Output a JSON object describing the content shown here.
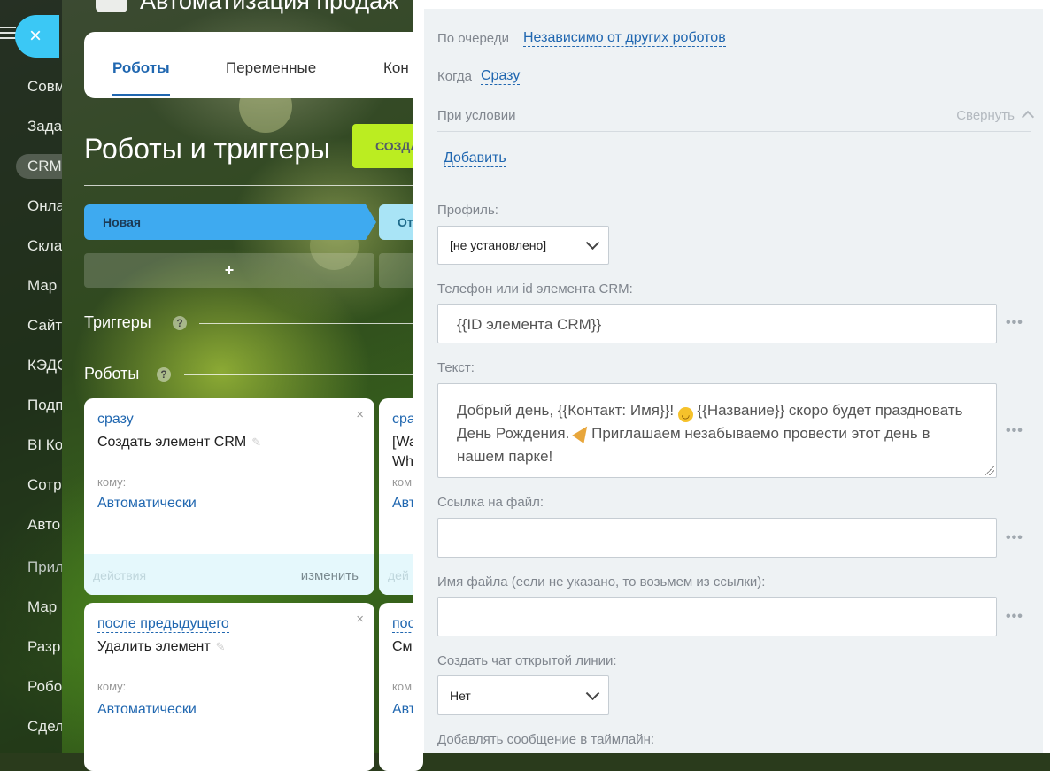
{
  "header": {
    "page_title": "Автоматизация продаж",
    "tabs": [
      {
        "label": "Роботы"
      },
      {
        "label": "Переменные"
      },
      {
        "label": "Кон"
      }
    ]
  },
  "left_menu": {
    "close_glyph": "×",
    "items": [
      {
        "label": "Совм"
      },
      {
        "label": "Зада"
      },
      {
        "label": "CRM"
      },
      {
        "label": "Онла"
      },
      {
        "label": "Скла"
      },
      {
        "label": "Мар"
      },
      {
        "label": "Сайт"
      },
      {
        "label": "КЭДО"
      },
      {
        "label": "Подп"
      },
      {
        "label": "BI Ко"
      },
      {
        "label": "Сотр"
      },
      {
        "label": "Авто"
      },
      {
        "label": "Прил"
      },
      {
        "label": "Мар"
      },
      {
        "label": "Разр"
      },
      {
        "label": "Робо"
      },
      {
        "label": "Сдел"
      }
    ]
  },
  "main": {
    "section_title": "Роботы и триггеры",
    "create_button": "созда",
    "stages": [
      {
        "label": "Новая",
        "color": "#3eaaf0"
      },
      {
        "label": "От",
        "color": "#a9e4f6"
      }
    ],
    "add_glyph": "+",
    "triggers_label": "Триггеры",
    "robots_label": "Роботы",
    "help_glyph": "?",
    "robot_cards": [
      {
        "when": "сразу",
        "title": "Создать элемент CRM",
        "to_label": "кому:",
        "responsible": "Автоматически",
        "actions_label": "действия",
        "edit_label": "изменить",
        "close_glyph": "×"
      },
      {
        "when": "сра",
        "title_line1": "[Wa",
        "title_line2": "Wh",
        "to_label": "ком",
        "responsible": "Авт",
        "actions_label": "дей"
      },
      {
        "when": "после предыдущего",
        "title": "Удалить элемент",
        "to_label": "кому:",
        "responsible": "Автоматически",
        "close_glyph": "×"
      },
      {
        "when": "пос",
        "title": "См",
        "to_label": "ком",
        "responsible": "Авт"
      }
    ]
  },
  "panel": {
    "queue_label": "По очереди",
    "queue_value": "Независимо от других роботов",
    "when_label": "Когда",
    "when_value": "Сразу",
    "condition_label": "При условии",
    "collapse_label": "Свернуть",
    "add_link": "Добавить",
    "profile_label": "Профиль:",
    "profile_value": "[не установлено]",
    "phone_label": "Телефон или id элемента CRM:",
    "phone_value": "{{ID элемента CRM}}",
    "text_label": "Текст:",
    "text_part1": "Добрый день, {{Контакт: Имя}}!",
    "text_part2": "{{Название}} скоро будет праздновать День Рождения.",
    "text_part3": "Приглашаем незабываемо провести этот день в нашем парке!",
    "file_link_label": "Ссылка на файл:",
    "file_link_value": "",
    "file_name_label": "Имя файла (если не указано, то возьмем из ссылки):",
    "file_name_value": "",
    "open_line_label": "Создать чат открытой линии:",
    "open_line_value": "Нет",
    "timeline_label": "Добавлять сообщение в таймлайн:",
    "more_glyph": "•••"
  }
}
